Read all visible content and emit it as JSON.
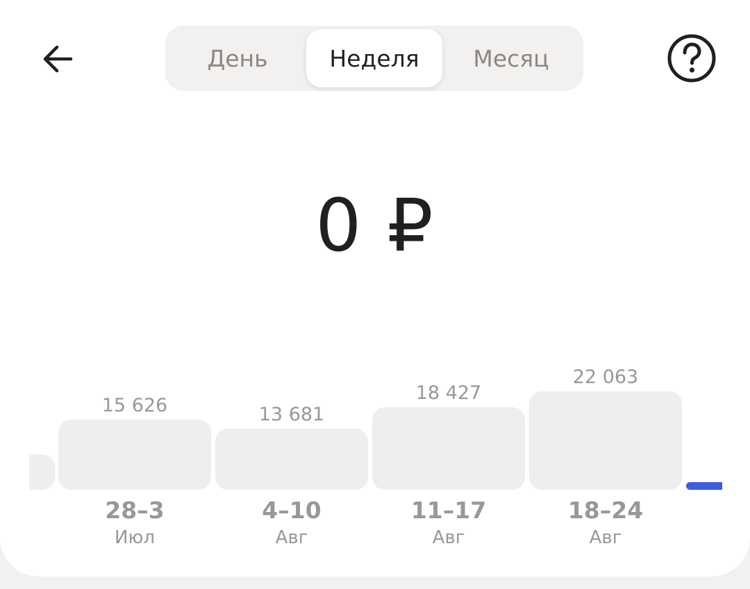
{
  "header": {
    "back_icon": "arrow-left-icon",
    "help_icon": "question-circle-icon"
  },
  "period_tabs": [
    {
      "label": "День",
      "active": false
    },
    {
      "label": "Неделя",
      "active": true
    },
    {
      "label": "Месяц",
      "active": false
    }
  ],
  "summary": {
    "amount": "0 ₽"
  },
  "chart_data": {
    "type": "bar",
    "categories": [
      "28–3 Июл",
      "4–10 Авг",
      "11–17 Авг",
      "18–24 Авг"
    ],
    "values": [
      15626,
      13681,
      18427,
      22063
    ],
    "value_labels": [
      "15 626",
      "13 681",
      "18 427",
      "22 063"
    ],
    "ranges": [
      "28–3",
      "4–10",
      "11–17",
      "18–24"
    ],
    "months": [
      "Июл",
      "Авг",
      "Авг",
      "Авг"
    ],
    "bar_color": "#eeeeee",
    "current_indicator_color": "#3f5be0",
    "current_value": 0
  }
}
